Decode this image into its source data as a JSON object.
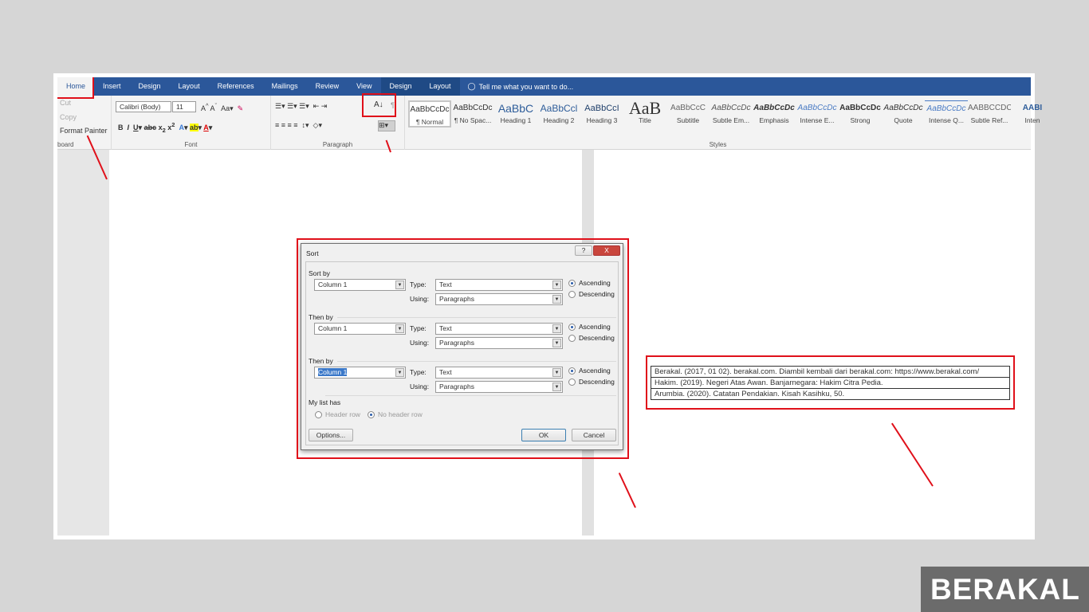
{
  "tabs": [
    "Home",
    "Insert",
    "Design",
    "Layout",
    "References",
    "Mailings",
    "Review",
    "View",
    "Design",
    "Layout"
  ],
  "tell_me": "Tell me what you want to do...",
  "clipboard": {
    "cut": "Cut",
    "copy": "Copy",
    "format_painter": "Format Painter",
    "label": "board"
  },
  "font": {
    "name": "Calibri (Body)",
    "size": "11",
    "label": "Font"
  },
  "paragraph": {
    "label": "Paragraph"
  },
  "styles": {
    "label": "Styles",
    "items": [
      {
        "preview": "AaBbCcDc",
        "name": "¶ Normal"
      },
      {
        "preview": "AaBbCcDc",
        "name": "¶ No Spac..."
      },
      {
        "preview": "AaBbC",
        "name": "Heading 1"
      },
      {
        "preview": "AaBbCcl",
        "name": "Heading 2"
      },
      {
        "preview": "AaBbCcI",
        "name": "Heading 3"
      },
      {
        "preview": "AaB",
        "name": "Title"
      },
      {
        "preview": "AaBbCcC",
        "name": "Subtitle"
      },
      {
        "preview": "AaBbCcDc",
        "name": "Subtle Em..."
      },
      {
        "preview": "AaBbCcDc",
        "name": "Emphasis"
      },
      {
        "preview": "AaBbCcDc",
        "name": "Intense E..."
      },
      {
        "preview": "AaBbCcDc",
        "name": "Strong"
      },
      {
        "preview": "AaBbCcDc",
        "name": "Quote"
      },
      {
        "preview": "AaBbCcDc",
        "name": "Intense Q..."
      },
      {
        "preview": "AABBCCDC",
        "name": "Subtle Ref..."
      },
      {
        "preview": "AABI",
        "name": "Inten"
      }
    ]
  },
  "dialog": {
    "title": "Sort",
    "help": "?",
    "close": "X",
    "sort_by": "Sort by",
    "then_by_1": "Then by",
    "then_by_2": "Then by",
    "levels": [
      {
        "column": "Column 1",
        "type": "Text",
        "using": "Paragraphs",
        "order": "Ascending"
      },
      {
        "column": "Column 1",
        "type": "Text",
        "using": "Paragraphs",
        "order": "Ascending"
      },
      {
        "column": "Column 1",
        "type": "Text",
        "using": "Paragraphs",
        "order": "Ascending"
      }
    ],
    "type_label": "Type:",
    "using_label": "Using:",
    "ascending": "Ascending",
    "descending": "Descending",
    "my_list_has": "My list has",
    "header_row": "Header row",
    "no_header_row": "No header row",
    "options": "Options...",
    "ok": "OK",
    "cancel": "Cancel"
  },
  "table_rows": [
    "Berakal. (2017, 01 02). berakal.com. Diambil kembali dari berakal.com: https://www.berakal.com/",
    "Hakim. (2019). Negeri Atas Awan. Banjarnegara: Hakim Citra Pedia.",
    "Arumbia. (2020). Catatan Pendakian. Kisah Kasihku, 50."
  ],
  "watermark": "BERAKAL",
  "colors": {
    "ribbon_blue": "#2b579a",
    "highlight_red": "#e0101a"
  }
}
